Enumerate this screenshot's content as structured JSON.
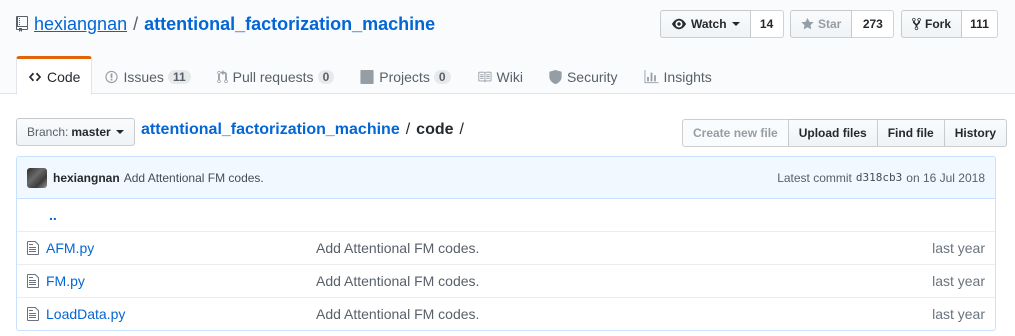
{
  "repo": {
    "owner": "hexiangnan",
    "separator": "/",
    "name": "attentional_factorization_machine"
  },
  "actions": {
    "watch_label": "Watch",
    "watch_count": "14",
    "star_label": "Star",
    "star_count": "273",
    "fork_label": "Fork",
    "fork_count": "111"
  },
  "tabs": [
    {
      "label": "Code",
      "counter": null,
      "icon": "code-icon"
    },
    {
      "label": "Issues",
      "counter": "11",
      "icon": "issue-icon"
    },
    {
      "label": "Pull requests",
      "counter": "0",
      "icon": "pull-request-icon"
    },
    {
      "label": "Projects",
      "counter": "0",
      "icon": "project-icon"
    },
    {
      "label": "Wiki",
      "counter": null,
      "icon": "book-icon"
    },
    {
      "label": "Security",
      "counter": null,
      "icon": "shield-icon"
    },
    {
      "label": "Insights",
      "counter": null,
      "icon": "graph-icon"
    }
  ],
  "branch": {
    "label": "Branch:",
    "value": "master"
  },
  "breadcrumb": {
    "root": "attentional_factorization_machine",
    "sep": "/",
    "current": "code",
    "trailing": "/"
  },
  "file_actions": {
    "create": "Create new file",
    "upload": "Upload files",
    "find": "Find file",
    "history": "History"
  },
  "commit": {
    "author": "hexiangnan",
    "message": "Add Attentional FM codes.",
    "latest_label": "Latest commit",
    "sha": "d318cb3",
    "date": "on 16 Jul 2018"
  },
  "files": {
    "up": "..",
    "rows": [
      {
        "name": "AFM.py",
        "message": "Add Attentional FM codes.",
        "age": "last year"
      },
      {
        "name": "FM.py",
        "message": "Add Attentional FM codes.",
        "age": "last year"
      },
      {
        "name": "LoadData.py",
        "message": "Add Attentional FM codes.",
        "age": "last year"
      }
    ]
  },
  "colors": {
    "link": "#0366d6",
    "tab_accent": "#e36209",
    "commit_bg": "#f1f8ff"
  }
}
